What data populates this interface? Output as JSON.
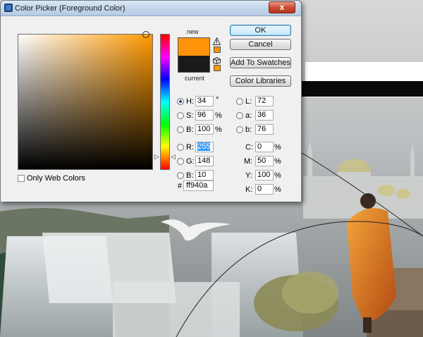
{
  "window": {
    "title": "Color Picker (Foreground Color)",
    "close_glyph": "x"
  },
  "swatches": {
    "new_label": "new",
    "current_label": "current",
    "new_color": "#ff940a",
    "current_color": "#1a1a1a",
    "gamut_warning_icon": "warning-triangle-icon",
    "web_safe_icon": "web-cube-icon"
  },
  "buttons": {
    "ok": "OK",
    "cancel": "Cancel",
    "add_to_swatches": "Add To Swatches",
    "color_libraries": "Color Libraries"
  },
  "hsb": [
    {
      "label": "H:",
      "value": "34",
      "unit": "°",
      "selected": true
    },
    {
      "label": "S:",
      "value": "96",
      "unit": "%",
      "selected": false
    },
    {
      "label": "B:",
      "value": "100",
      "unit": "%",
      "selected": false
    }
  ],
  "rgb": [
    {
      "label": "R:",
      "value": "255",
      "selected": false
    },
    {
      "label": "G:",
      "value": "148",
      "selected": false
    },
    {
      "label": "B:",
      "value": "10",
      "selected": false
    }
  ],
  "lab": [
    {
      "label": "L:",
      "value": "72"
    },
    {
      "label": "a:",
      "value": "36"
    },
    {
      "label": "b:",
      "value": "76"
    }
  ],
  "cmyk": [
    {
      "label": "C:",
      "value": "0",
      "unit": "%"
    },
    {
      "label": "M:",
      "value": "50",
      "unit": "%"
    },
    {
      "label": "Y:",
      "value": "100",
      "unit": "%"
    },
    {
      "label": "K:",
      "value": "0",
      "unit": "%"
    }
  ],
  "hex": {
    "hash": "#",
    "value": "ff940a"
  },
  "options": {
    "only_web_colors": "Only Web Colors"
  },
  "colors": {
    "hue_base": "#ff9900",
    "accent_blue": "#3399ff"
  }
}
